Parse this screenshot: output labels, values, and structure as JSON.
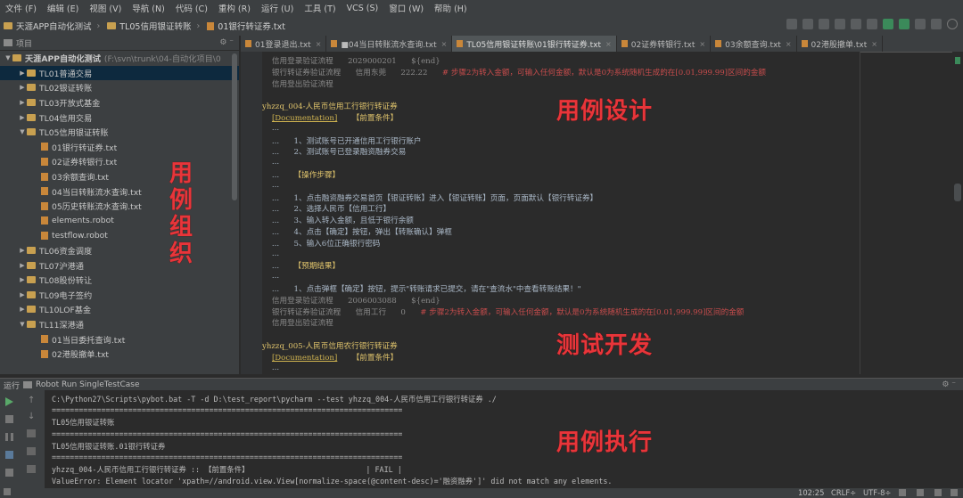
{
  "menu": [
    "文件 (F)",
    "编辑 (E)",
    "视图 (V)",
    "导航 (N)",
    "代码 (C)",
    "重构 (R)",
    "运行 (U)",
    "工具 (T)",
    "VCS (S)",
    "窗口 (W)",
    "帮助 (H)"
  ],
  "breadcrumb": [
    "天涯APP自动化测试",
    "TL05信用银证转账",
    "01银行转证券.txt"
  ],
  "project_header": "项目",
  "tree": [
    {
      "label": "天涯APP自动化测试",
      "suffix": "(F:\\svn\\trunk\\04-自动化项目\\0",
      "type": "folder",
      "level": 0,
      "open": true
    },
    {
      "label": "TL01普通交易",
      "type": "folder",
      "level": 1,
      "open": false,
      "selected": true
    },
    {
      "label": "TL02银证转账",
      "type": "folder",
      "level": 1,
      "open": false
    },
    {
      "label": "TL03开放式基金",
      "type": "folder",
      "level": 1,
      "open": false
    },
    {
      "label": "TL04信用交易",
      "type": "folder",
      "level": 1,
      "open": false
    },
    {
      "label": "TL05信用银证转账",
      "type": "folder",
      "level": 1,
      "open": true
    },
    {
      "label": "01银行转证券.txt",
      "type": "file",
      "level": 2
    },
    {
      "label": "02证券转银行.txt",
      "type": "file",
      "level": 2
    },
    {
      "label": "03余额查询.txt",
      "type": "file",
      "level": 2
    },
    {
      "label": "04当日转账流水查询.txt",
      "type": "file",
      "level": 2
    },
    {
      "label": "05历史转账流水查询.txt",
      "type": "file",
      "level": 2
    },
    {
      "label": "elements.robot",
      "type": "file",
      "level": 2
    },
    {
      "label": "testflow.robot",
      "type": "file",
      "level": 2
    },
    {
      "label": "TL06资金调度",
      "type": "folder",
      "level": 1,
      "open": false
    },
    {
      "label": "TL07沪港通",
      "type": "folder",
      "level": 1,
      "open": false
    },
    {
      "label": "TL08股份转让",
      "type": "folder",
      "level": 1,
      "open": false
    },
    {
      "label": "TL09电子签约",
      "type": "folder",
      "level": 1,
      "open": false
    },
    {
      "label": "TL10LOF基金",
      "type": "folder",
      "level": 1,
      "open": false
    },
    {
      "label": "TL11深港通",
      "type": "folder",
      "level": 1,
      "open": true
    },
    {
      "label": "01当日委托查询.txt",
      "type": "file",
      "level": 2
    },
    {
      "label": "02港股撤单.txt",
      "type": "file",
      "level": 2
    }
  ],
  "tabs": [
    {
      "label": "01登录退出.txt",
      "active": false
    },
    {
      "label": "■04当日转账流水查询.txt",
      "active": false
    },
    {
      "label": "TL05信用银证转账\\01银行转证券.txt",
      "active": true
    },
    {
      "label": "02证券转银行.txt",
      "active": false
    },
    {
      "label": "03余额查询.txt",
      "active": false
    },
    {
      "label": "02港股撤单.txt",
      "active": false
    }
  ],
  "editor_lines": [
    {
      "segs": [
        {
          "t": "    信用登录验证流程      2029000201      ${end}",
          "c": "g"
        }
      ]
    },
    {
      "segs": [
        {
          "t": "    银行转证券验证流程      信用东莞      222.22      ",
          "c": "g"
        },
        {
          "t": "# 步骤2为转入金额，可输入任何金额，默认是0为系统随机生成的在[0.01,999.99]区间的金额",
          "c": "r"
        }
      ]
    },
    {
      "segs": [
        {
          "t": "    信用登出验证流程",
          "c": "g"
        }
      ]
    },
    {
      "segs": [
        {
          "t": "",
          "c": ""
        }
      ]
    },
    {
      "segs": [
        {
          "t": "yhzzq_004-人民币信用工行银行转证券",
          "c": "y"
        }
      ]
    },
    {
      "segs": [
        {
          "t": "    ",
          "c": ""
        },
        {
          "t": "[Documentation]",
          "c": "doc"
        },
        {
          "t": "      【前置条件】",
          "c": "y"
        }
      ]
    },
    {
      "segs": [
        {
          "t": "    ...",
          "c": ""
        }
      ]
    },
    {
      "segs": [
        {
          "t": "    ...      1、测试账号已开通信用工行银行账户",
          "c": ""
        }
      ]
    },
    {
      "segs": [
        {
          "t": "    ...      2、测试账号已登录融资融券交易",
          "c": ""
        }
      ]
    },
    {
      "segs": [
        {
          "t": "    ...",
          "c": ""
        }
      ]
    },
    {
      "segs": [
        {
          "t": "    ...      ",
          "c": ""
        },
        {
          "t": "【操作步骤】",
          "c": "y"
        }
      ]
    },
    {
      "segs": [
        {
          "t": "    ...",
          "c": ""
        }
      ]
    },
    {
      "segs": [
        {
          "t": "    ...      1、点击融资融券交易首页【银证转账】进入【银证转账】页面，页面默认【银行转证券】",
          "c": ""
        }
      ]
    },
    {
      "segs": [
        {
          "t": "    ...      2、选择人民币【信用工行】",
          "c": ""
        }
      ]
    },
    {
      "segs": [
        {
          "t": "    ...      3、输入转入金额，且低于银行余额",
          "c": ""
        }
      ]
    },
    {
      "segs": [
        {
          "t": "    ...      4、点击【确定】按钮，弹出【转账确认】弹框",
          "c": ""
        }
      ]
    },
    {
      "segs": [
        {
          "t": "    ...      5、输入6位正确银行密码",
          "c": ""
        }
      ]
    },
    {
      "segs": [
        {
          "t": "    ...",
          "c": ""
        }
      ]
    },
    {
      "segs": [
        {
          "t": "    ...      ",
          "c": ""
        },
        {
          "t": "【预期结果】",
          "c": "y"
        }
      ]
    },
    {
      "segs": [
        {
          "t": "    ...",
          "c": ""
        }
      ]
    },
    {
      "segs": [
        {
          "t": "    ...      1、点击弹框【确定】按钮，提示\"转账请求已提交，请在\"查流水\"中查看转账结果！\"",
          "c": ""
        }
      ]
    },
    {
      "segs": [
        {
          "t": "    信用登录验证流程      2006003088      ${end}",
          "c": "g"
        }
      ]
    },
    {
      "segs": [
        {
          "t": "    银行转证券验证流程      信用工行      0      ",
          "c": "g"
        },
        {
          "t": "# 步骤2为转入金额，可输入任何金额，默认是0为系统随机生成的在[0.01,999.99]区间的金额",
          "c": "r"
        }
      ]
    },
    {
      "segs": [
        {
          "t": "    信用登出验证流程",
          "c": "g"
        }
      ]
    },
    {
      "segs": [
        {
          "t": "",
          "c": ""
        }
      ]
    },
    {
      "segs": [
        {
          "t": "yhzzq_005-人民币信用农行银行转证券",
          "c": "y"
        }
      ]
    },
    {
      "segs": [
        {
          "t": "    ",
          "c": ""
        },
        {
          "t": "[Documentation]",
          "c": "doc"
        },
        {
          "t": "      【前置条件】",
          "c": "y"
        }
      ]
    },
    {
      "segs": [
        {
          "t": "    ...",
          "c": ""
        }
      ]
    }
  ],
  "run_header": {
    "label": "运行",
    "config": "Robot Run SingleTestCase"
  },
  "console_lines": [
    "C:\\Python27\\Scripts\\pybot.bat -T -d D:\\test_report\\pycharm --test yhzzq_004-人民币信用工行银行转证券 ./",
    "==============================================================================",
    "TL05信用银证转账",
    "==============================================================================",
    "TL05信用银证转账.01银行转证券",
    "==============================================================================",
    "yhzzq_004-人民币信用工行银行转证券 :: 【前置条件】                          | FAIL |",
    "ValueError: Element locator 'xpath=//android.view.View[normalize-space(@content-desc)='融资融券']' did not match any elements."
  ],
  "status": {
    "position": "102:25",
    "line_sep": "CRLF÷",
    "encoding": "UTF-8÷"
  },
  "overlays": {
    "design": "用例设计",
    "organize": "用例组织",
    "develop": "测试开发",
    "execute": "用例执行"
  }
}
